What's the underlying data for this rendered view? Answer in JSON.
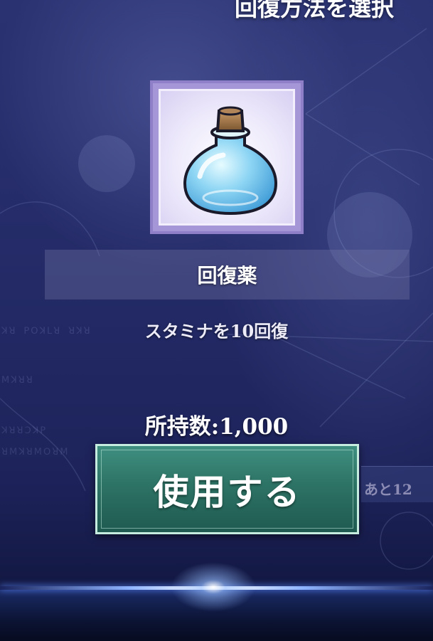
{
  "header": {
    "title": "回復方法を選択"
  },
  "item": {
    "name": "回復薬",
    "description": "スタミナを10回復",
    "owned_label": "所持数:1,000",
    "icon": "potion-bottle-icon"
  },
  "actions": {
    "use_label": "使用する"
  },
  "side_panel": {
    "text": "あと12"
  },
  "colors": {
    "background": "#1f2660",
    "button": "#2d7365",
    "button_border": "#c6ece0",
    "frame": "#8f7fc8"
  }
}
